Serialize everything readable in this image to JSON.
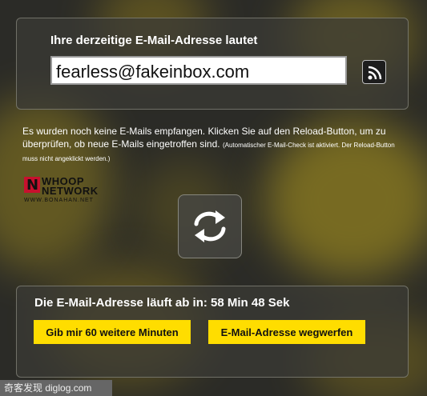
{
  "header": {
    "title": "Ihre derzeitige E-Mail-Adresse lautet"
  },
  "email": {
    "address": "fearless@fakeinbox.com"
  },
  "info": {
    "text": "Es wurden noch keine E-Mails empfangen. Klicken Sie auf den Reload-Button, um zu überprüfen, ob neue E-Mails eingetroffen sind.",
    "note": "(Automatischer E-Mail-Check ist aktiviert. Der Reload-Button muss nicht angeklickt werden.)"
  },
  "logo": {
    "line1": "WHOOP",
    "line2": "NETWORK",
    "line3": "WWW.BONAHAN.NET"
  },
  "expiry": {
    "text": "Die E-Mail-Adresse läuft ab in: 58 Min 48 Sek"
  },
  "buttons": {
    "extend": "Gib mir 60 weitere Minuten",
    "discard": "E-Mail-Adresse wegwerfen"
  },
  "footer": {
    "text": "奇客发现 diglog.com"
  },
  "icons": {
    "rss": "rss-icon",
    "reload": "reload-icon"
  },
  "colors": {
    "accent": "#ffdd00",
    "background": "#2b2b27"
  }
}
